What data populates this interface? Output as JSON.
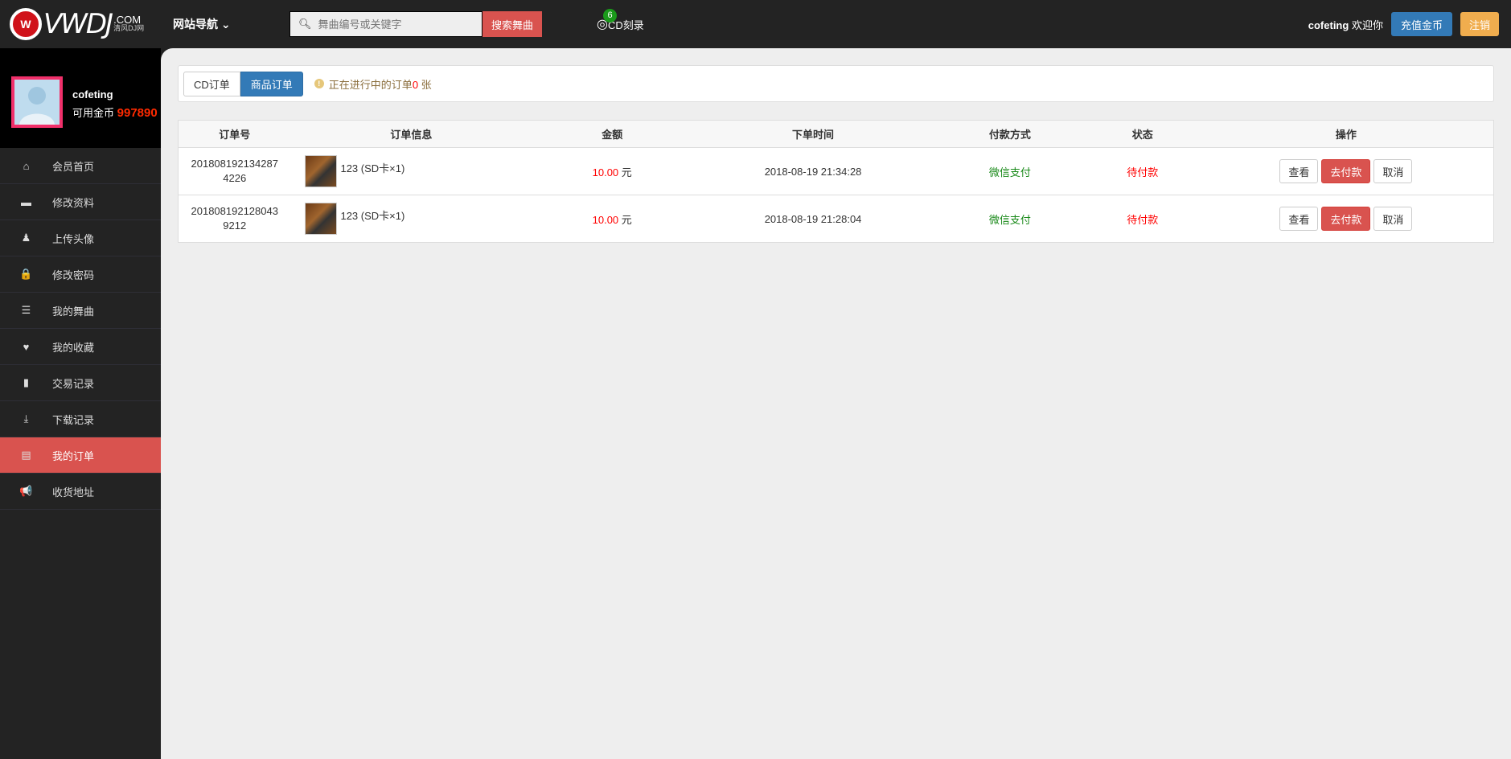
{
  "header": {
    "logo_text": "VWDJ",
    "logo_domain": ".COM",
    "logo_sub": "清风DJ网",
    "nav_label": "网站导航",
    "search_placeholder": "舞曲编号或关键字",
    "search_button": "搜索舞曲",
    "cd_label": "CD刻录",
    "cd_count": "6",
    "username": "cofeting",
    "welcome": "欢迎你",
    "recharge_button": "充值金币",
    "logout_button": "注销"
  },
  "profile": {
    "name": "cofeting",
    "coin_label": "可用金币",
    "coins": "997890"
  },
  "sidebar": {
    "items": [
      {
        "label": "会员首页",
        "icon": "home-icon",
        "glyph": "⌂"
      },
      {
        "label": "修改资料",
        "icon": "folder-icon",
        "glyph": "▬"
      },
      {
        "label": "上传头像",
        "icon": "user-icon",
        "glyph": "♟"
      },
      {
        "label": "修改密码",
        "icon": "lock-icon",
        "glyph": "🔒"
      },
      {
        "label": "我的舞曲",
        "icon": "list-icon",
        "glyph": "☰"
      },
      {
        "label": "我的收藏",
        "icon": "heart-icon",
        "glyph": "♥"
      },
      {
        "label": "交易记录",
        "icon": "file-icon",
        "glyph": "▮"
      },
      {
        "label": "下载记录",
        "icon": "download-icon",
        "glyph": "⤓"
      },
      {
        "label": "我的订单",
        "icon": "order-icon",
        "glyph": "▤"
      },
      {
        "label": "收货地址",
        "icon": "bullhorn-icon",
        "glyph": "📢"
      }
    ],
    "active_index": 8
  },
  "tabs": {
    "cd": "CD订单",
    "goods": "商品订单",
    "notice_prefix": "正在进行中的订单",
    "notice_count": "0",
    "notice_suffix": " 张"
  },
  "table": {
    "headers": [
      "订单号",
      "订单信息",
      "金额",
      "下单时间",
      "付款方式",
      "状态",
      "操作"
    ],
    "rows": [
      {
        "order_no": "2018081921342874226",
        "item": "123 (SD卡×1)",
        "amount": "10.00",
        "currency": "元",
        "time": "2018-08-19 21:34:28",
        "payment": "微信支付",
        "status": "待付款"
      },
      {
        "order_no": "2018081921280439212",
        "item": "123 (SD卡×1)",
        "amount": "10.00",
        "currency": "元",
        "time": "2018-08-19 21:28:04",
        "payment": "微信支付",
        "status": "待付款"
      }
    ],
    "actions": {
      "view": "查看",
      "pay": "去付款",
      "cancel": "取消"
    }
  }
}
